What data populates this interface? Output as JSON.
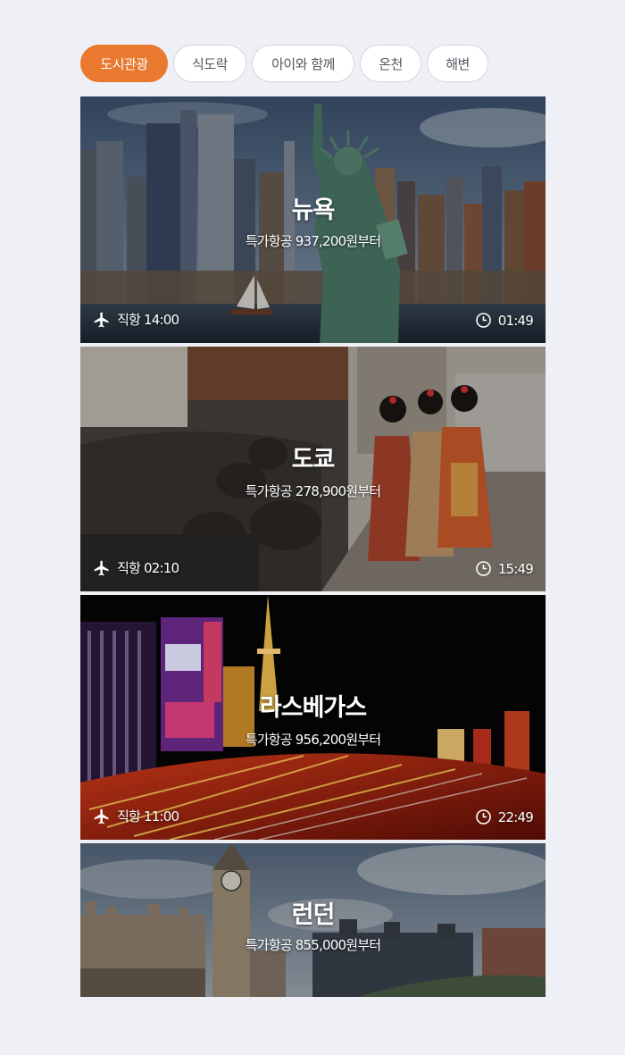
{
  "tabs": [
    {
      "label": "도시관광",
      "active": true
    },
    {
      "label": "식도락",
      "active": false
    },
    {
      "label": "아이와 함께",
      "active": false
    },
    {
      "label": "온천",
      "active": false
    },
    {
      "label": "해변",
      "active": false
    }
  ],
  "colors": {
    "accent": "#e8792f",
    "background": "#eff0f6"
  },
  "icons": {
    "flight": "airplane-icon",
    "duration": "clock-icon"
  },
  "destinations": [
    {
      "city": "뉴욕",
      "price_text": "특가항공 937,200원부터",
      "flight_label": "직항",
      "flight_time": "14:00",
      "duration": "01:49"
    },
    {
      "city": "도쿄",
      "price_text": "특가항공 278,900원부터",
      "flight_label": "직항",
      "flight_time": "02:10",
      "duration": "15:49"
    },
    {
      "city": "라스베가스",
      "price_text": "특가항공 956,200원부터",
      "flight_label": "직항",
      "flight_time": "11:00",
      "duration": "22:49"
    },
    {
      "city": "런던",
      "price_text": "특가항공 855,000원부터"
    }
  ]
}
